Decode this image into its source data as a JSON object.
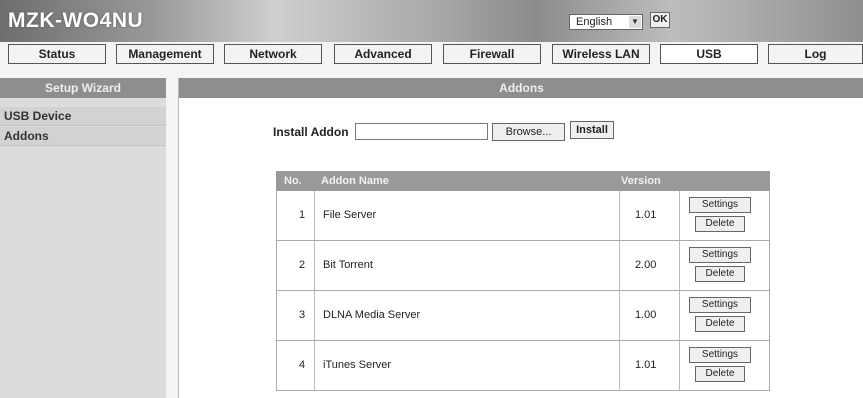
{
  "header": {
    "brand": "MZK-WO4NU",
    "language": "English",
    "ok_label": "OK"
  },
  "nav": {
    "tabs": [
      "Status",
      "Management",
      "Network",
      "Advanced",
      "Firewall",
      "Wireless LAN",
      "USB",
      "Log"
    ]
  },
  "sidebar": {
    "title": "Setup Wizard",
    "items": [
      "USB Device",
      "Addons"
    ]
  },
  "main": {
    "title": "Addons",
    "install_label": "Install Addon",
    "install_value": "",
    "browse_label": "Browse...",
    "install_button": "Install"
  },
  "table": {
    "headers": [
      "No.",
      "Addon Name",
      "Version"
    ],
    "rows": [
      {
        "no": "1",
        "name": "File Server",
        "version": "1.01"
      },
      {
        "no": "2",
        "name": "Bit Torrent",
        "version": "2.00"
      },
      {
        "no": "3",
        "name": "DLNA Media Server",
        "version": "1.00"
      },
      {
        "no": "4",
        "name": "iTunes Server",
        "version": "1.01"
      }
    ],
    "settings_label": "Settings",
    "delete_label": "Delete"
  }
}
